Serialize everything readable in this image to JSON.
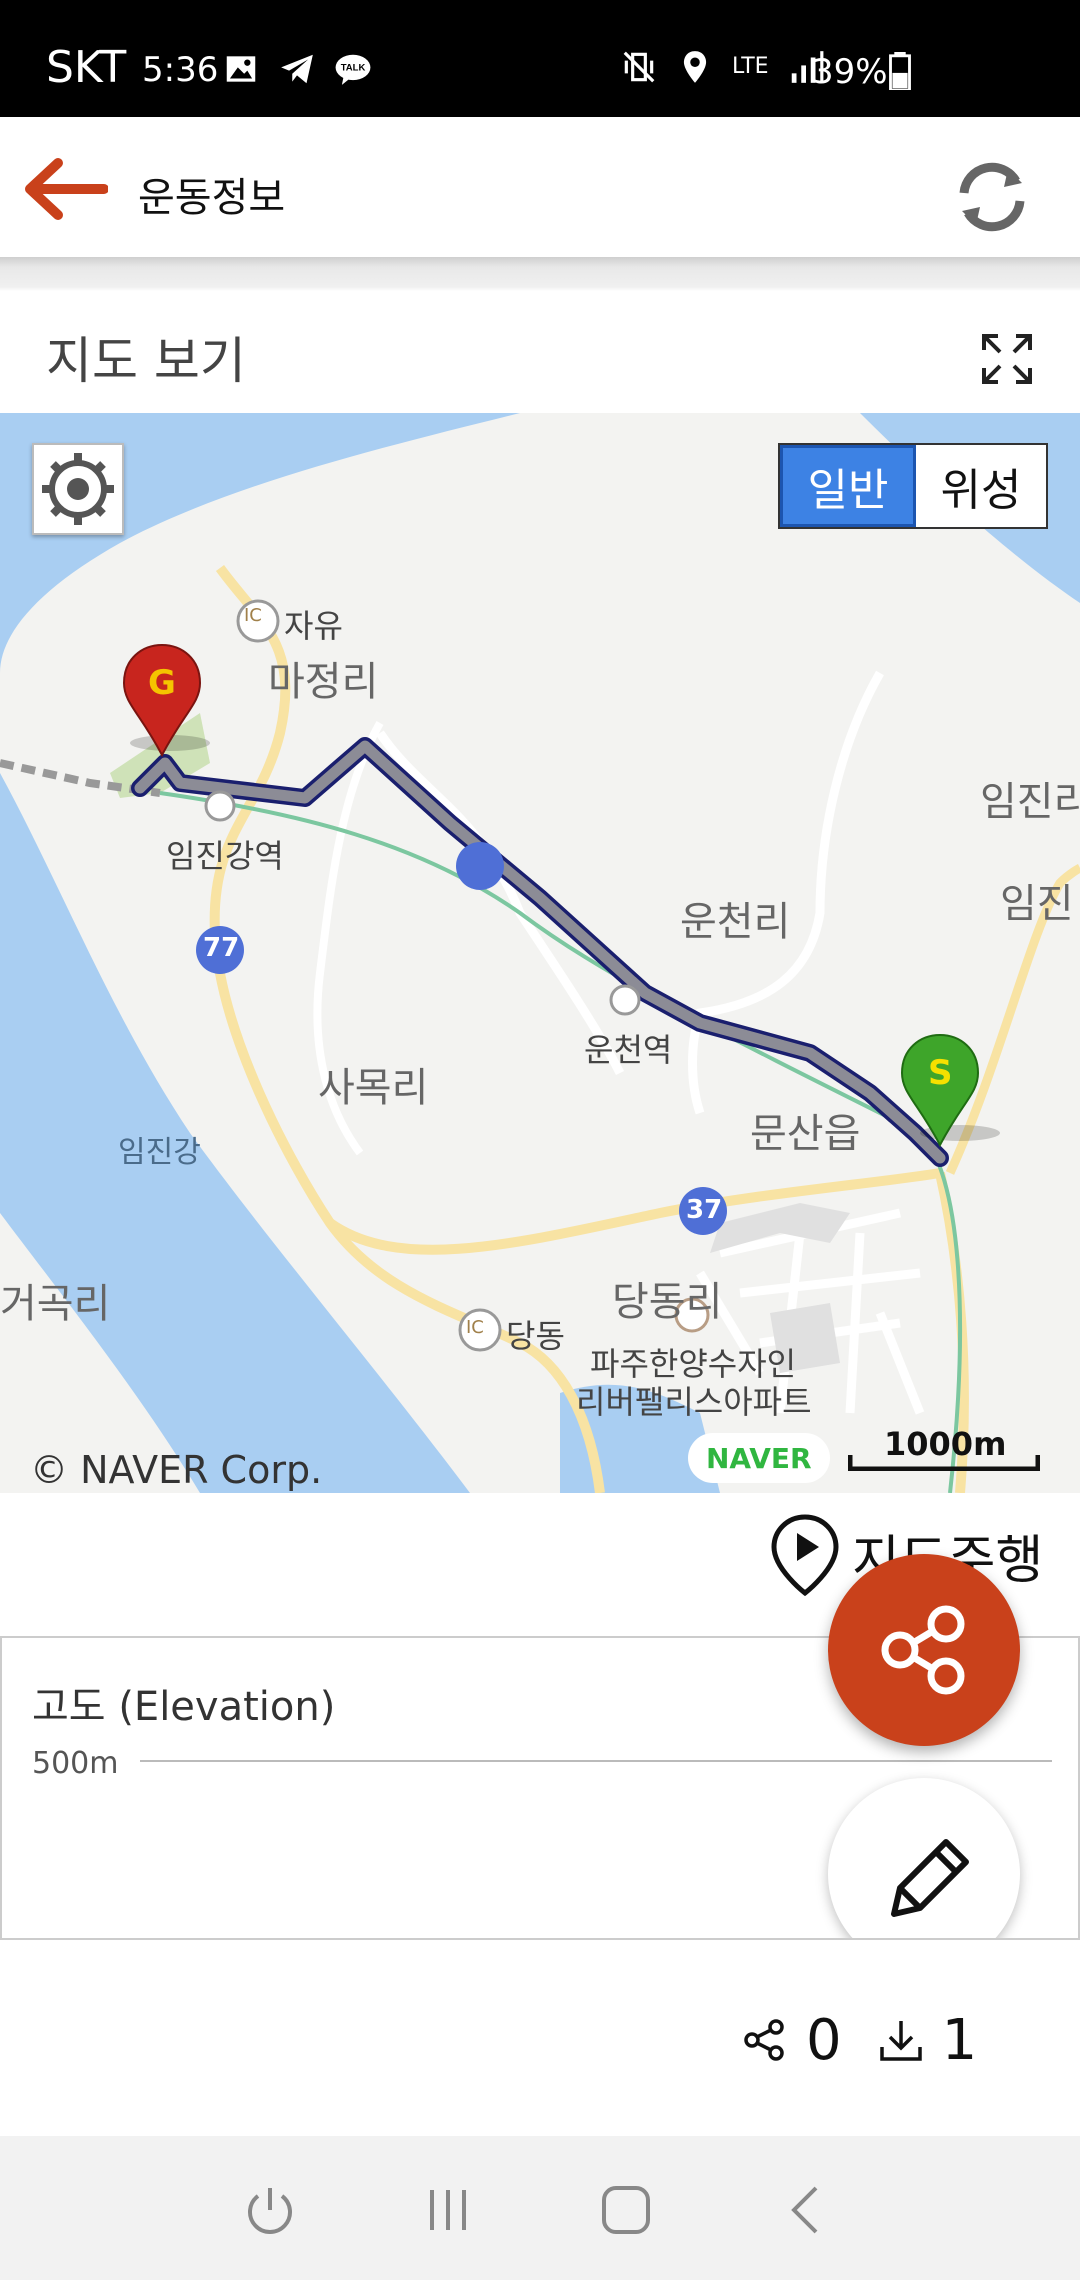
{
  "status_bar": {
    "carrier": "SKT",
    "time": "5:36",
    "network": "LTE",
    "battery": "39%",
    "left_icons": [
      "gallery-icon",
      "telegram-icon",
      "kakaotalk-icon"
    ],
    "right_icons": [
      "vibrate-icon",
      "location-icon",
      "lte-icon",
      "signal-icon",
      "battery-icon"
    ]
  },
  "header": {
    "title": "운동정보",
    "back_icon": "arrow-left-icon",
    "refresh_icon": "refresh-icon"
  },
  "map_section": {
    "title": "지도 보기",
    "fullscreen_icon": "fullscreen-icon",
    "map_type": {
      "normal": "일반",
      "satellite": "위성",
      "selected": "일반"
    },
    "labels": {
      "jayu": "자유",
      "majeong": "마정리",
      "imjingang_station": "임진강역",
      "route_77": "77",
      "route_37": "37",
      "samok": "사목리",
      "imjingang": "임진강",
      "geogok": "거곡리",
      "uncheon": "운천리",
      "uncheon_station": "운천역",
      "munsan": "문산읍",
      "dangdong_ri": "당동리",
      "dangdong_ic": "당동",
      "apartment_line1": "파주한양수자인",
      "apartment_line2": "리버팰리스아파트",
      "imjin_r1": "임진리",
      "imjin_r2": "임진",
      "ic": "IC",
      "goal_marker": "G",
      "start_marker": "S"
    },
    "copyright": "© NAVER Corp.",
    "naver_logo": "NAVER",
    "scale": "1000m"
  },
  "navigation": {
    "label": "지도주행",
    "icon": "map-pin-play-icon"
  },
  "elevation": {
    "title": "고도 (Elevation)",
    "tick": "500m"
  },
  "fab": {
    "share_icon": "share-icon",
    "edit_icon": "pencil-icon"
  },
  "counts": {
    "shares": "0",
    "downloads": "1"
  },
  "colors": {
    "accent": "#c9411b",
    "selected_map_type": "#3d82e4",
    "route": "#8c8c96",
    "route_outline": "#1a1f6e",
    "river": "#a9cef2"
  }
}
